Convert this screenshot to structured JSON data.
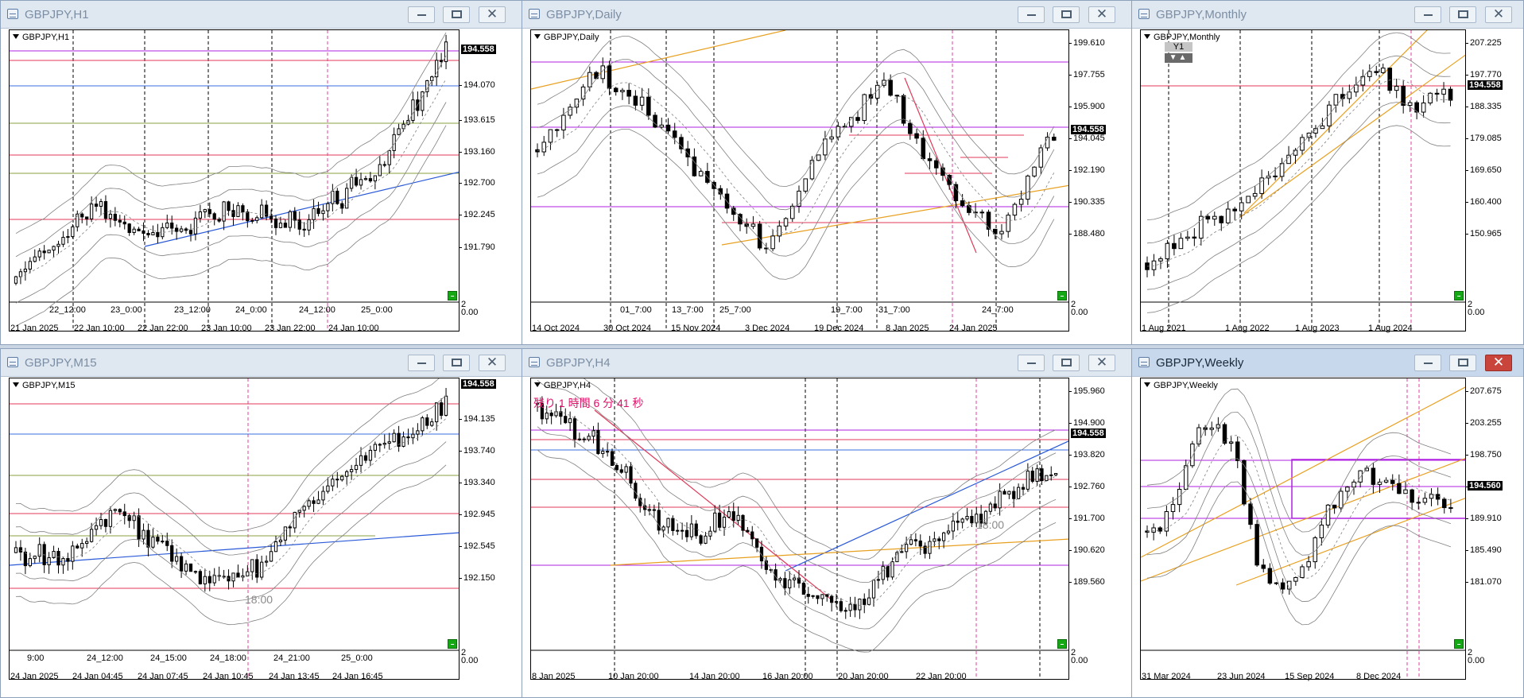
{
  "price": "194.558",
  "windows": [
    {
      "key": "h1",
      "title": "GBPJPY,H1",
      "label": "GBPJPY,H1",
      "active": false,
      "y_ticks": [
        "194.070",
        "193.615",
        "193.160",
        "192.700",
        "192.245",
        "191.790"
      ],
      "price_label": "194.558",
      "x_labels": [
        "21 Jan 2025",
        "22 Jan 10:00",
        "22 Jan 22:00",
        "23 Jan 10:00",
        "23 Jan 22:00",
        "24 Jan 10:00"
      ],
      "inner_labels": [
        "22_12:00",
        "23_0:00",
        "23_12:00",
        "24_0:00",
        "24_12:00",
        "25_0:00"
      ],
      "ind": [
        "2",
        "0.00"
      ]
    },
    {
      "key": "daily",
      "title": "GBPJPY,Daily",
      "label": "GBPJPY,Daily",
      "active": false,
      "y_ticks": [
        "199.610",
        "197.755",
        "195.900",
        "194.045",
        "192.190",
        "190.335",
        "188.480"
      ],
      "price_label": "194.558",
      "x_labels": [
        "14 Oct 2024",
        "30 Oct 2024",
        "15 Nov 2024",
        "3 Dec 2024",
        "19 Dec 2024",
        "8 Jan 2025",
        "24 Jan 2025"
      ],
      "inner_labels": [
        "01_7:00",
        "13_7:00",
        "25_7:00",
        "19_7:00",
        "31_7:00",
        "24_7:00"
      ],
      "ind": [
        "2",
        "0.00"
      ]
    },
    {
      "key": "monthly",
      "title": "GBPJPY,Monthly",
      "label": "GBPJPY,Monthly",
      "active": false,
      "y_ticks": [
        "207.225",
        "197.770",
        "188.335",
        "179.085",
        "169.650",
        "160.400",
        "150.965"
      ],
      "price_label": "194.558",
      "x_labels": [
        "1 Aug 2021",
        "1 Aug 2022",
        "1 Aug 2023",
        "1 Aug 2024"
      ],
      "inner_labels": [],
      "period_button": "Y1",
      "ind": [
        "2",
        "0.00"
      ]
    },
    {
      "key": "m15",
      "title": "GBPJPY,M15",
      "label": "GBPJPY,M15",
      "active": false,
      "y_ticks": [
        "194.135",
        "193.740",
        "193.340",
        "192.945",
        "192.545",
        "192.150"
      ],
      "price_label": "194.558",
      "x_labels": [
        "24 Jan 2025",
        "24 Jan 04:45",
        "24 Jan 07:45",
        "24 Jan 10:45",
        "24 Jan 13:45",
        "24 Jan 16:45"
      ],
      "inner_labels": [
        "9:00",
        "24_12:00",
        "24_15:00",
        "24_18:00",
        "24_21:00",
        "25_0:00"
      ],
      "annotation": "18:00",
      "ind": [
        "2",
        "0.00"
      ]
    },
    {
      "key": "h4",
      "title": "GBPJPY,H4",
      "label": "GBPJPY,H4",
      "active": false,
      "y_ticks": [
        "195.960",
        "194.900",
        "193.820",
        "192.760",
        "191.700",
        "190.620",
        "189.560"
      ],
      "price_label": "194.558",
      "x_labels": [
        "8 Jan 2025",
        "10 Jan 20:00",
        "14 Jan 20:00",
        "16 Jan 20:00",
        "20 Jan 20:00",
        "22 Jan 20:00"
      ],
      "inner_labels": [],
      "countdown": "残り 1 時間 6 分 41 秒",
      "annotation": "18:00",
      "ind": [
        "2",
        "0.00"
      ]
    },
    {
      "key": "weekly",
      "title": "GBPJPY,Weekly",
      "label": "GBPJPY,Weekly",
      "active": true,
      "y_ticks": [
        "207.675",
        "203.255",
        "198.750",
        "194.560",
        "189.910",
        "185.490",
        "181.070"
      ],
      "price_label": "194.560",
      "x_labels": [
        "31 Mar 2024",
        "23 Jun 2024",
        "15 Sep 2024",
        "8 Dec 2024"
      ],
      "inner_labels": [],
      "ind": [
        "2",
        "0.00"
      ]
    }
  ],
  "colors": {
    "candle": "#000000",
    "band": "#808080",
    "ma_dash": "#808080",
    "hline_red": "#e03a5a",
    "hline_purple": "#b020e0",
    "hline_blue": "#3a6ee0",
    "hline_olive": "#8aa040",
    "trend_orange": "#e8a020",
    "trend_blue": "#2a5ad8",
    "vline_magenta": "#e040a0",
    "indicator": "#14a814"
  }
}
